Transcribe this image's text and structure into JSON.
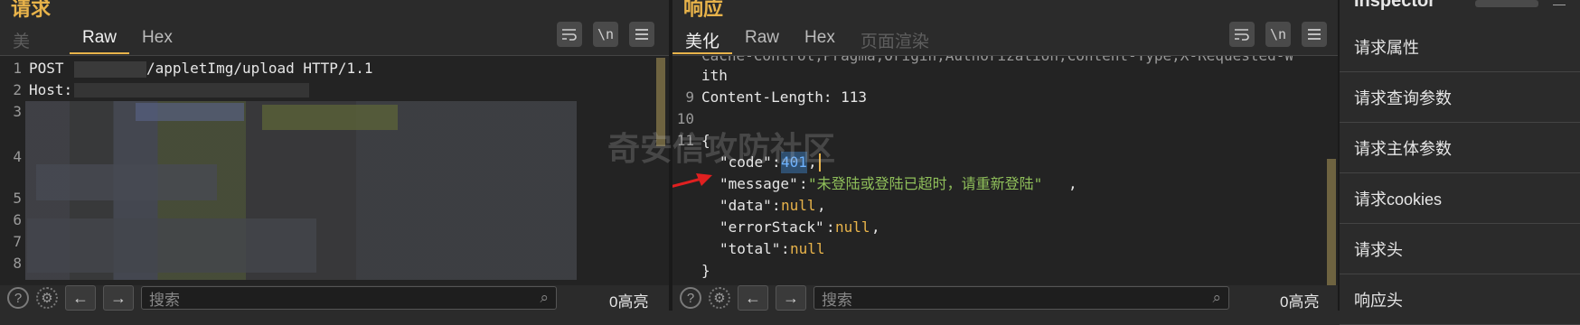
{
  "request": {
    "title": "请求",
    "tabs": [
      "美",
      "Raw",
      "Hex"
    ],
    "active_tab": "Raw",
    "toolbar": {
      "wrap_icon": "wrap-lines-icon",
      "newline_label": "\\n",
      "menu_icon": "hamburger-menu-icon"
    },
    "lines": {
      "l1_method": "POST",
      "l1_path": "/appletImg/upload HTTP/1.1",
      "l2_host": "Host:"
    },
    "line_numbers": [
      "1",
      "2",
      "3",
      "4",
      "5",
      "6",
      "7",
      "8"
    ],
    "search_placeholder": "搜索",
    "hits": "0高亮"
  },
  "response": {
    "title": "响应",
    "tabs": [
      "美化",
      "Raw",
      "Hex",
      "页面渲染"
    ],
    "active_tab": "美化",
    "toolbar": {
      "newline_label": "\\n"
    },
    "partial_line": "Cache-Control,Pragma,Origin,Authorization,Content-Type,X-Requested-W",
    "partial_line_cont": "ith",
    "line_numbers": [
      "9",
      "10",
      "11"
    ],
    "content_length": "Content-Length: 113",
    "json": {
      "open": "{",
      "code_key": "\"code\"",
      "code_val": "401",
      "message_key": "\"message\"",
      "message_val": "\"未登陆或登陆已超时，请重新登陆\"",
      "data_key": "\"data\"",
      "data_val": "null",
      "error_key": "\"errorStack\"",
      "error_val": "null",
      "total_key": "\"total\"",
      "total_val": "null",
      "close": "}"
    },
    "search_placeholder": "搜索",
    "hits": "0高亮"
  },
  "inspector": {
    "title": "Inspector",
    "items": [
      "请求属性",
      "请求查询参数",
      "请求主体参数",
      "请求cookies",
      "请求头",
      "响应头"
    ]
  },
  "watermark": "奇安信攻防社区",
  "colors": {
    "accent": "#e8b34a",
    "bg": "#2b2b2b",
    "editor_bg": "#232323",
    "string_green": "#8fbf5a",
    "arrow": "#e02020"
  }
}
